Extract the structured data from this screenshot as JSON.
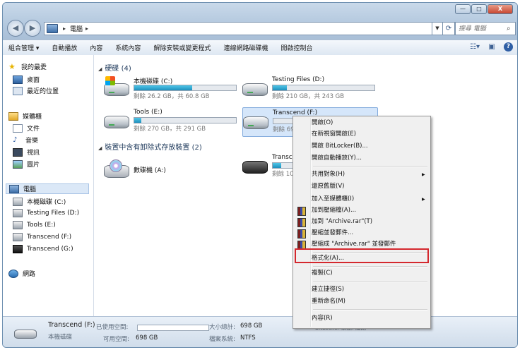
{
  "window": {
    "buttons": {
      "minimize": "—",
      "maximize": "□",
      "close": "X"
    }
  },
  "address": {
    "location": "電腦",
    "search_placeholder": "搜尋 電腦"
  },
  "toolbar": {
    "items": [
      "組合管理 ▾",
      "自動播放",
      "內容",
      "系統內容",
      "解除安裝或變更程式",
      "連線網路磁碟機",
      "開啟控制台"
    ]
  },
  "sidebar": {
    "favorites": "我的最愛",
    "desktop": "桌面",
    "recent": "最近的位置",
    "libraries": "媒體櫃",
    "documents": "文件",
    "music": "音樂",
    "videos": "視訊",
    "pictures": "圖片",
    "computer": "電腦",
    "drive_c": "本機磁碟 (C:)",
    "drive_d": "Testing Files (D:)",
    "drive_e": "Tools (E:)",
    "drive_f": "Transcend (F:)",
    "drive_g": "Transcend (G:)",
    "network": "網路"
  },
  "main": {
    "hdd_group": "硬碟 (4)",
    "removable_group": "裝置中含有卸除式存放裝置 (2)",
    "drives": [
      {
        "name": "本機磁碟 (C:)",
        "info": "剩餘 26.2 GB，共 60.8 GB",
        "used_fraction": 0.57
      },
      {
        "name": "Testing Files (D:)",
        "info": "剩餘 210 GB，共 243 GB",
        "used_fraction": 0.14
      },
      {
        "name": "Tools (E:)",
        "info": "剩餘 270 GB，共 291 GB",
        "used_fraction": 0.07
      },
      {
        "name": "Transcend (F:)",
        "info": "剩餘 69",
        "used_fraction": 0.0
      }
    ],
    "removable": [
      {
        "name": "數碟機 (A:)"
      },
      {
        "name": "Transce",
        "info": "剩餘 10",
        "used_fraction": 0.3
      }
    ]
  },
  "context_menu": {
    "items": [
      {
        "label": "開啟(O)"
      },
      {
        "label": "在新視窗開啟(E)"
      },
      {
        "label": "開啟 BitLocker(B)..."
      },
      {
        "label": "開啟自動播放(Y)..."
      },
      {
        "label": "共用對象(H)"
      },
      {
        "label": "還原舊版(V)"
      },
      {
        "label": "加入至媒體櫃(I)"
      },
      {
        "label": "加到壓縮檔(A)..."
      },
      {
        "label": "加到 \"Archive.rar\"(T)"
      },
      {
        "label": "壓縮並發郵件..."
      },
      {
        "label": "壓縮成 \"Archive.rar\" 並發郵件"
      },
      {
        "label": "格式化(A)..."
      },
      {
        "label": "複製(C)"
      },
      {
        "label": "建立捷徑(S)"
      },
      {
        "label": "重新命名(M)"
      },
      {
        "label": "內容(R)"
      }
    ],
    "highlight_color": "#d4282e"
  },
  "status": {
    "drive_name": "Transcend (F:)",
    "drive_type": "本機磁碟",
    "used_label": "已使用空間:",
    "free_label": "可用空間:",
    "free_value": "698 GB",
    "total_label": "大小總計:",
    "total_value": "698 GB",
    "fs_label": "檔案系統:",
    "fs_value": "NTFS",
    "bitlocker": "BitLocker 狀態: 關閉"
  }
}
